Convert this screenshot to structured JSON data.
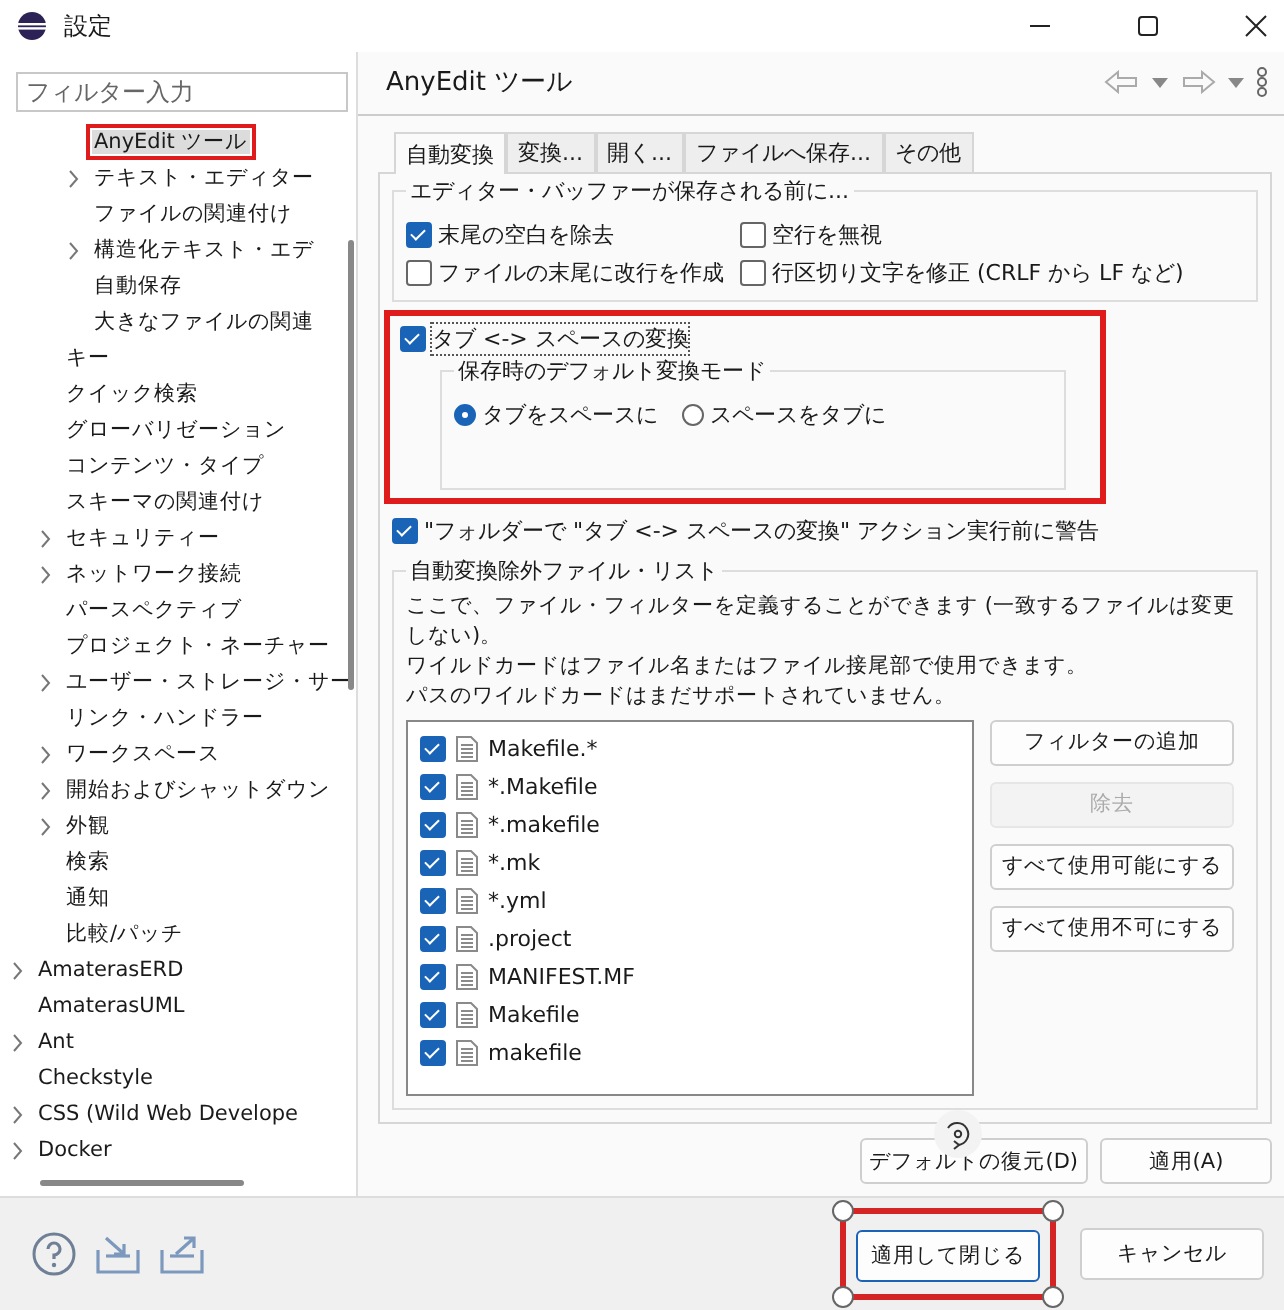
{
  "window": {
    "title": "設定"
  },
  "filter": {
    "placeholder": "フィルター入力"
  },
  "tree": [
    {
      "children": [
        {
          "children": [
            {
              "label": "AnyEdit ツール",
              "expandable": false,
              "selected": true,
              "highlighted": true
            },
            {
              "label": "テキスト・エディター",
              "expandable": true,
              "selected": false,
              "highlighted": false
            },
            {
              "label": "ファイルの関連付け",
              "expandable": false,
              "selected": false,
              "highlighted": false
            },
            {
              "label": "構造化テキスト・エデ",
              "expandable": true,
              "selected": false,
              "highlighted": false
            },
            {
              "label": "自動保存",
              "expandable": false,
              "selected": false,
              "highlighted": false
            },
            {
              "label": "大きなファイルの関連",
              "expandable": false,
              "selected": false,
              "highlighted": false
            }
          ]
        },
        {
          "label": "キー",
          "expandable": false,
          "selected": false,
          "highlighted": false
        },
        {
          "label": "クイック検索",
          "expandable": false,
          "selected": false,
          "highlighted": false
        },
        {
          "label": "グローバリゼーション",
          "expandable": false,
          "selected": false,
          "highlighted": false
        },
        {
          "label": "コンテンツ・タイプ",
          "expandable": false,
          "selected": false,
          "highlighted": false
        },
        {
          "label": "スキーマの関連付け",
          "expandable": false,
          "selected": false,
          "highlighted": false
        },
        {
          "label": "セキュリティー",
          "expandable": true,
          "selected": false,
          "highlighted": false
        },
        {
          "label": "ネットワーク接続",
          "expandable": true,
          "selected": false,
          "highlighted": false
        },
        {
          "label": "パースペクティブ",
          "expandable": false,
          "selected": false,
          "highlighted": false
        },
        {
          "label": "プロジェクト・ネーチャー",
          "expandable": false,
          "selected": false,
          "highlighted": false
        },
        {
          "label": "ユーザー・ストレージ・サー",
          "expandable": true,
          "selected": false,
          "highlighted": false
        },
        {
          "label": "リンク・ハンドラー",
          "expandable": false,
          "selected": false,
          "highlighted": false
        },
        {
          "label": "ワークスペース",
          "expandable": true,
          "selected": false,
          "highlighted": false
        },
        {
          "label": "開始およびシャットダウン",
          "expandable": true,
          "selected": false,
          "highlighted": false
        },
        {
          "label": "外観",
          "expandable": true,
          "selected": false,
          "highlighted": false
        },
        {
          "label": "検索",
          "expandable": false,
          "selected": false,
          "highlighted": false
        },
        {
          "label": "通知",
          "expandable": false,
          "selected": false,
          "highlighted": false
        },
        {
          "label": "比較/パッチ",
          "expandable": false,
          "selected": false,
          "highlighted": false
        }
      ]
    },
    {
      "label": "AmaterasERD",
      "expandable": true,
      "selected": false,
      "highlighted": false
    },
    {
      "label": "AmaterasUML",
      "expandable": false,
      "selected": false,
      "highlighted": false
    },
    {
      "label": "Ant",
      "expandable": true,
      "selected": false,
      "highlighted": false
    },
    {
      "label": "Checkstyle",
      "expandable": false,
      "selected": false,
      "highlighted": false
    },
    {
      "label": "CSS (Wild Web Develope",
      "expandable": true,
      "selected": false,
      "highlighted": false
    },
    {
      "label": "Docker",
      "expandable": true,
      "selected": false,
      "highlighted": false
    }
  ],
  "page": {
    "title": "AnyEdit ツール"
  },
  "tabs": [
    {
      "label": "自動変換",
      "selected": true
    },
    {
      "label": "変換...",
      "selected": false
    },
    {
      "label": "開く...",
      "selected": false
    },
    {
      "label": "ファイルへ保存...",
      "selected": false
    },
    {
      "label": "その他",
      "selected": false
    }
  ],
  "buffer_group": {
    "label": "エディター・バッファーが保存される前に...",
    "options": [
      {
        "label": "末尾の空白を除去",
        "checked": true
      },
      {
        "label": "空行を無視",
        "checked": false
      },
      {
        "label": "ファイルの末尾に改行を作成",
        "checked": false
      },
      {
        "label": "行区切り文字を修正 (CRLF から LF など)",
        "checked": false
      }
    ]
  },
  "tab_conversion": {
    "label": "タブ <-> スペースの変換",
    "checked": true,
    "highlighted": true,
    "mode_group": {
      "label": "保存時のデフォルト変換モード",
      "options": [
        {
          "label": "タブをスペースに",
          "selected": true
        },
        {
          "label": "スペースをタブに",
          "selected": false
        }
      ]
    }
  },
  "warn": {
    "label": "\"フォルダーで \"タブ <-> スペースの変換\" アクション実行前に警告",
    "checked": true
  },
  "exclude_group": {
    "label": "自動変換除外ファイル・リスト",
    "description": [
      "ここで、ファイル・フィルターを定義することができます (一致するファイルは変更しない)。",
      "ワイルドカードはファイル名またはファイル接尾部で使用できます。",
      "パスのワイルドカードはまだサポートされていません。"
    ],
    "files": [
      {
        "name": "Makefile.*",
        "checked": true
      },
      {
        "name": "*.Makefile",
        "checked": true
      },
      {
        "name": "*.makefile",
        "checked": true
      },
      {
        "name": "*.mk",
        "checked": true
      },
      {
        "name": "*.yml",
        "checked": true
      },
      {
        "name": ".project",
        "checked": true
      },
      {
        "name": "MANIFEST.MF",
        "checked": true
      },
      {
        "name": "Makefile",
        "checked": true
      },
      {
        "name": "makefile",
        "checked": true
      }
    ],
    "buttons": [
      {
        "label": "フィルターの追加",
        "disabled": false
      },
      {
        "label": "除去",
        "disabled": true
      },
      {
        "label": "すべて使用可能にする",
        "disabled": false
      },
      {
        "label": "すべて使用不可にする",
        "disabled": false
      }
    ]
  },
  "page_buttons": [
    "デフォルトの復元(D)",
    "適用(A)"
  ],
  "dialog_buttons": [
    {
      "label": "適用して閉じる",
      "default": true,
      "highlighted": true
    },
    {
      "label": "キャンセル",
      "default": false,
      "highlighted": false
    }
  ]
}
